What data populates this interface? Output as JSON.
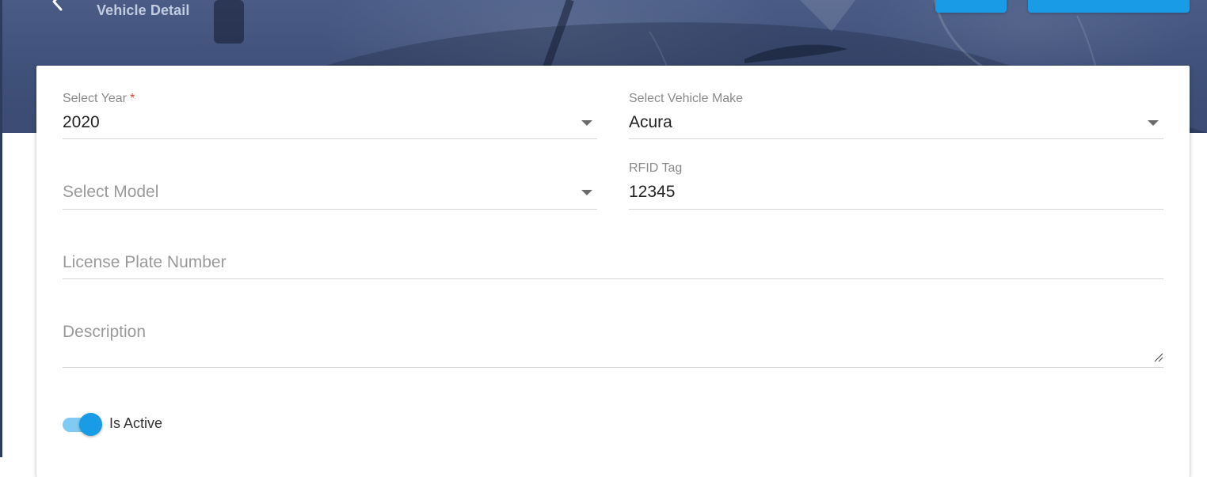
{
  "header": {
    "subtitle": "Vehicle Detail",
    "back_icon": "chevron-left-icon",
    "buttons": [
      {
        "label": ""
      },
      {
        "label": ""
      }
    ]
  },
  "form": {
    "year": {
      "label": "Select Year",
      "required_mark": "*",
      "value": "2020"
    },
    "make": {
      "label": "Select Vehicle Make",
      "value": "Acura"
    },
    "model": {
      "placeholder": "Select Model"
    },
    "rfid": {
      "label": "RFID Tag",
      "value": "12345"
    },
    "license_plate": {
      "placeholder": "License Plate Number"
    },
    "description": {
      "placeholder": "Description"
    },
    "is_active": {
      "label": "Is Active",
      "checked": true
    }
  },
  "colors": {
    "header_bg": "#3f5079",
    "accent": "#1a9be6",
    "toggle_track": "#7fcbf3",
    "required": "#e53935"
  }
}
